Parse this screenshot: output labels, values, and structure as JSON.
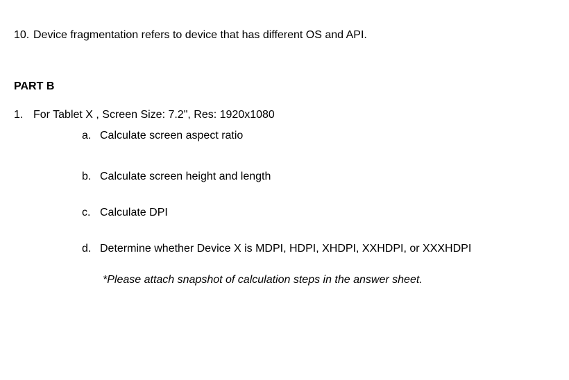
{
  "q10": {
    "number": "10.",
    "text": "Device fragmentation refers to device that has different OS and API."
  },
  "partB": {
    "heading": "PART B",
    "q1": {
      "number": "1.",
      "intro": "For Tablet X , Screen Size: 7.2\", Res: 1920x1080",
      "items": {
        "a": {
          "marker": "a.",
          "text": "Calculate screen  aspect ratio"
        },
        "b": {
          "marker": "b.",
          "text": "Calculate screen height and length"
        },
        "c": {
          "marker": "c.",
          "text": "Calculate DPI"
        },
        "d": {
          "marker": "d.",
          "text": "Determine  whether Device X is MDPI, HDPI, XHDPI, XXHDPI, or XXXHDPI"
        }
      },
      "note": "*Please attach snapshot of calculation steps in the answer sheet."
    }
  }
}
